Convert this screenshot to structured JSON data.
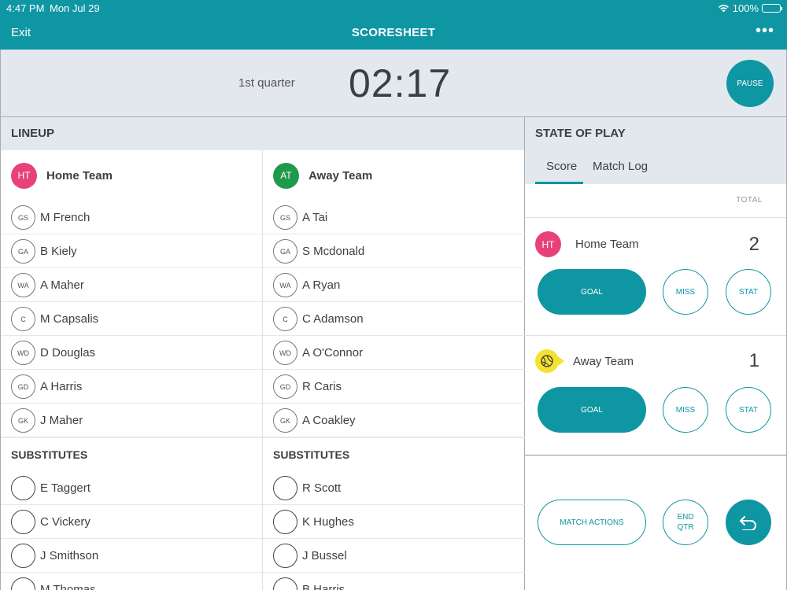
{
  "status": {
    "time": "4:47 PM",
    "date": "Mon Jul 29",
    "battery": "100%"
  },
  "nav": {
    "exit": "Exit",
    "title": "SCORESHEET"
  },
  "timer": {
    "quarter": "1st quarter",
    "clock": "02:17",
    "pause": "PAUSE"
  },
  "lineup": {
    "header": "LINEUP",
    "home": {
      "badge": "HT",
      "name": "Home Team",
      "color": "#e8407a",
      "players": [
        {
          "pos": "GS",
          "name": "M French"
        },
        {
          "pos": "GA",
          "name": "B Kiely"
        },
        {
          "pos": "WA",
          "name": "A Maher"
        },
        {
          "pos": "C",
          "name": "M Capsalis"
        },
        {
          "pos": "WD",
          "name": "D Douglas"
        },
        {
          "pos": "GD",
          "name": "A Harris"
        },
        {
          "pos": "GK",
          "name": "J Maher"
        }
      ],
      "subs_header": "SUBSTITUTES",
      "subs": [
        "E Taggert",
        "C Vickery",
        "J Smithson",
        "M Thomas"
      ]
    },
    "away": {
      "badge": "AT",
      "name": "Away Team",
      "color": "#1f9a4b",
      "players": [
        {
          "pos": "GS",
          "name": "A Tai"
        },
        {
          "pos": "GA",
          "name": "S Mcdonald"
        },
        {
          "pos": "WA",
          "name": "A Ryan"
        },
        {
          "pos": "C",
          "name": "C Adamson"
        },
        {
          "pos": "WD",
          "name": "A O'Connor"
        },
        {
          "pos": "GD",
          "name": "R Caris"
        },
        {
          "pos": "GK",
          "name": "A Coakley"
        }
      ],
      "subs_header": "SUBSTITUTES",
      "subs": [
        "R Scott",
        "K Hughes",
        "J Bussel",
        "B Harris"
      ]
    }
  },
  "state_of_play": {
    "header": "STATE OF PLAY",
    "tabs": [
      {
        "label": "Score",
        "active": true
      },
      {
        "label": "Match Log",
        "active": false
      }
    ],
    "total_label": "TOTAL",
    "home": {
      "badge": "HT",
      "name": "Home Team",
      "score": "2"
    },
    "away": {
      "name": "Away Team",
      "score": "1",
      "possession_icon": "netball-icon"
    },
    "buttons": {
      "goal": "GOAL",
      "miss": "MISS",
      "stat": "STAT"
    },
    "actions": {
      "match_actions": "MATCH ACTIONS",
      "end_qtr_1": "END",
      "end_qtr_2": "QTR",
      "undo_icon": "undo-icon"
    }
  },
  "colors": {
    "accent": "#0f96a3",
    "panel_bg": "#e3e7ee",
    "possession": "#f4e132"
  }
}
